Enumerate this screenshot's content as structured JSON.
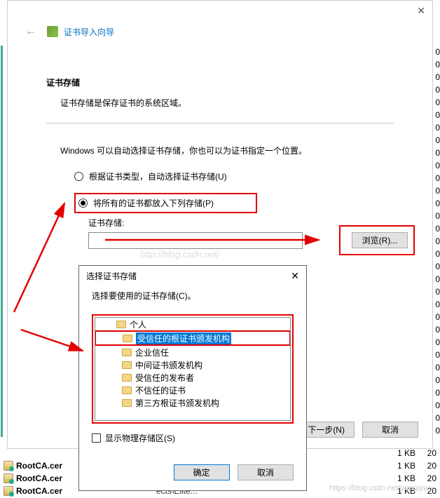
{
  "wizard": {
    "title": "证书导入向导",
    "section_title": "证书存储",
    "section_desc": "证书存储是保存证书的系统区域。",
    "instruction": "Windows 可以自动选择证书存储，你也可以为证书指定一个位置。",
    "radio_auto": "根据证书类型，自动选择证书存储(U)",
    "radio_manual": "将所有的证书都放入下列存储(P)",
    "store_label": "证书存储:",
    "browse": "浏览(R)...",
    "next": "下一步(N)",
    "cancel": "取消"
  },
  "sub": {
    "title": "选择证书存储",
    "desc": "选择要使用的证书存储(C)。",
    "items": {
      "personal": "个人",
      "trusted_root": "受信任的根证书颁发机构",
      "enterprise": "企业信任",
      "intermediate": "中间证书颁发机构",
      "trusted_pub": "受信任的发布者",
      "untrusted": "不信任的证书",
      "third_party": "第三方根证书颁发机构"
    },
    "show_physical": "显示物理存储区(S)",
    "ok": "确定",
    "cancel": "取消"
  },
  "files": {
    "name": "RootCA.cer",
    "path": "ects\\Elite...",
    "size": "1 KB",
    "date": "20"
  },
  "zeros": "0",
  "watermark": "https://blog.csdn.net/yongqiwu"
}
